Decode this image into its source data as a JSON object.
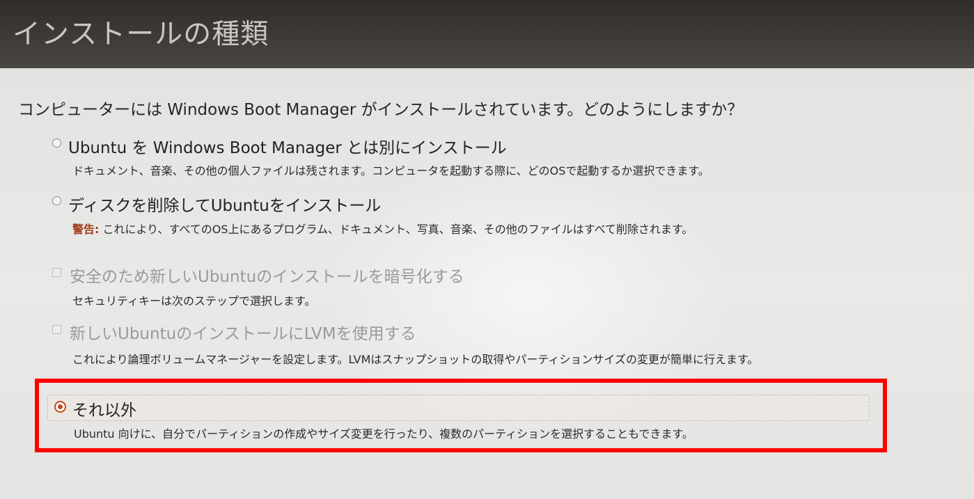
{
  "window": {
    "title": "インストールの種類"
  },
  "question": "コンピューターには Windows Boot Manager がインストールされています。どのようにしますか？",
  "options": [
    {
      "type": "radio",
      "checked": false,
      "enabled": true,
      "title": "Ubuntu を Windows Boot Manager とは別にインストール",
      "description": "ドキュメント、音楽、その他の個人ファイルは残されます。コンピュータを起動する際に、どのOSで起動するか選択できます。"
    },
    {
      "type": "radio",
      "checked": false,
      "enabled": true,
      "title": "ディスクを削除してUbuntuをインストール",
      "warning_label": "警告:",
      "description": " これにより、すべてのOS上にあるプログラム、ドキュメント、写真、音楽、その他のファイルはすべて削除されます。"
    },
    {
      "type": "checkbox",
      "checked": false,
      "enabled": false,
      "title": "安全のため新しいUbuntuのインストールを暗号化する",
      "description": "セキュリティキーは次のステップで選択します。"
    },
    {
      "type": "checkbox",
      "checked": false,
      "enabled": false,
      "title": "新しいUbuntuのインストールにLVMを使用する",
      "description": "これにより論理ボリュームマネージャーを設定します。LVMはスナップショットの取得やパーティションサイズの変更が簡単に行えます。"
    },
    {
      "type": "radio",
      "checked": true,
      "enabled": true,
      "title": "それ以外",
      "description": "Ubuntu 向けに、自分でパーティションの作成やサイズ変更を行ったり、複数のパーティションを選択することもできます。"
    }
  ],
  "colors": {
    "titlebar": "#3c3935",
    "accent": "#c14a1d",
    "warning": "#a33c1a",
    "annotation_box": "#ff0000"
  }
}
